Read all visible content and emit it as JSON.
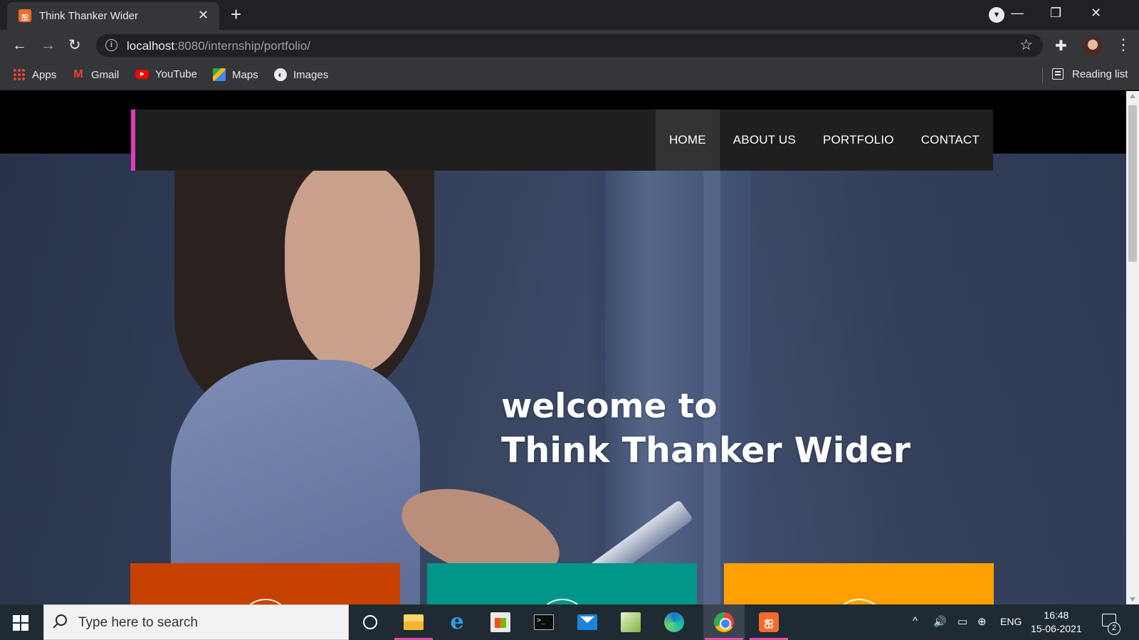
{
  "browser": {
    "tab_title": "Think Thanker Wider",
    "tab_favicon": "xampp-icon",
    "tab_close": "✕",
    "new_tab": "+",
    "window_controls": {
      "minimize": "—",
      "restore": "❐",
      "close": "✕"
    },
    "url_host": "localhost",
    "url_rest": ":8080/internship/portfolio/",
    "bookmarks": [
      {
        "label": "Apps",
        "icon": "apps-grid-icon"
      },
      {
        "label": "Gmail",
        "icon": "gmail-icon"
      },
      {
        "label": "YouTube",
        "icon": "youtube-icon"
      },
      {
        "label": "Maps",
        "icon": "maps-icon"
      },
      {
        "label": "Images",
        "icon": "images-icon"
      }
    ],
    "reading_list": "Reading list"
  },
  "site": {
    "nav": [
      {
        "label": "HOME",
        "active": true
      },
      {
        "label": "ABOUT US",
        "active": false
      },
      {
        "label": "PORTFOLIO",
        "active": false
      },
      {
        "label": "CONTACT",
        "active": false
      }
    ],
    "hero": {
      "line1": "welcome to",
      "line2": "Think Thanker Wider"
    },
    "feature_colors": [
      "#c74100",
      "#00968a",
      "#ffa000"
    ],
    "accent_color": "#e03cb5"
  },
  "taskbar": {
    "search_placeholder": "Type here to search",
    "apps": [
      "cortana-icon",
      "file-explorer-icon",
      "internet-explorer-icon",
      "store-icon",
      "terminal-icon",
      "mail-icon",
      "photos-icon",
      "edge-icon",
      "chrome-icon",
      "xampp-icon"
    ],
    "language": "ENG",
    "time": "16:48",
    "date": "15-06-2021",
    "notification_count": "2"
  }
}
